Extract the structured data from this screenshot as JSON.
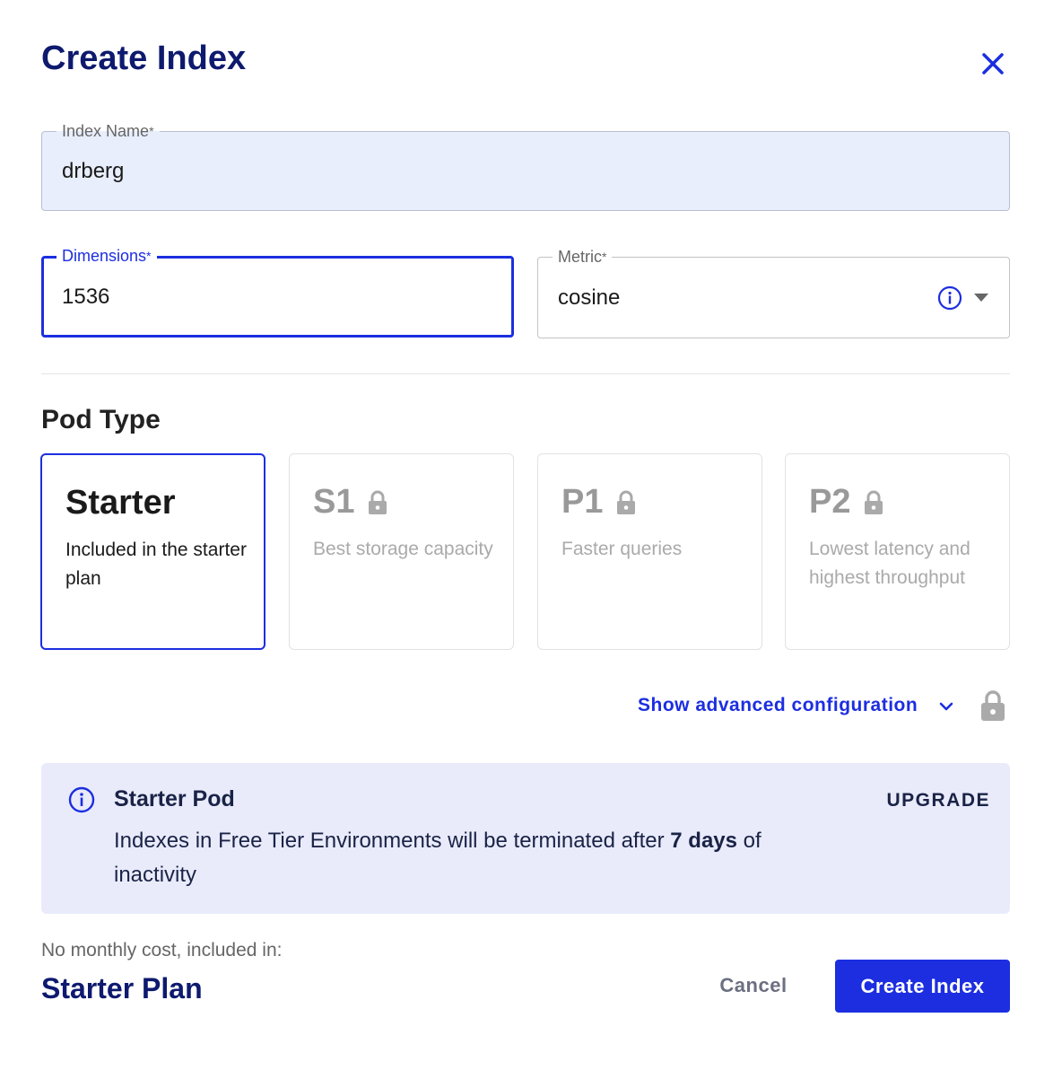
{
  "dialog": {
    "title": "Create Index"
  },
  "fields": {
    "index_name": {
      "label": "Index Name",
      "required_mark": "*",
      "value": "drberg"
    },
    "dimensions": {
      "label": "Dimensions",
      "required_mark": "*",
      "value": "1536"
    },
    "metric": {
      "label": "Metric",
      "required_mark": "*",
      "value": "cosine"
    }
  },
  "pod_type": {
    "title": "Pod Type",
    "options": [
      {
        "name": "Starter",
        "description": "Included in the starter plan",
        "selected": true,
        "locked": false
      },
      {
        "name": "S1",
        "description": "Best storage capacity",
        "selected": false,
        "locked": true
      },
      {
        "name": "P1",
        "description": "Faster queries",
        "selected": false,
        "locked": true
      },
      {
        "name": "P2",
        "description": "Lowest latency and highest throughput",
        "selected": false,
        "locked": true
      }
    ]
  },
  "advanced": {
    "label": "Show advanced configuration"
  },
  "alert": {
    "title": "Starter Pod",
    "action": "UPGRADE",
    "body_before": "Indexes in Free Tier Environments will be terminated after ",
    "body_bold": "7 days",
    "body_after": " of inactivity"
  },
  "footer": {
    "cost_label": "No monthly cost, included in:",
    "plan": "Starter Plan",
    "cancel": "Cancel",
    "submit": "Create Index"
  },
  "colors": {
    "accent": "#1c2ee0",
    "navy": "#0e1a6e",
    "alert_bg": "#e9ebfb",
    "field_bg": "#e8eefc"
  },
  "icons": [
    "close-icon",
    "info-icon",
    "caret-down-icon",
    "lock-icon",
    "chevron-down-icon"
  ]
}
